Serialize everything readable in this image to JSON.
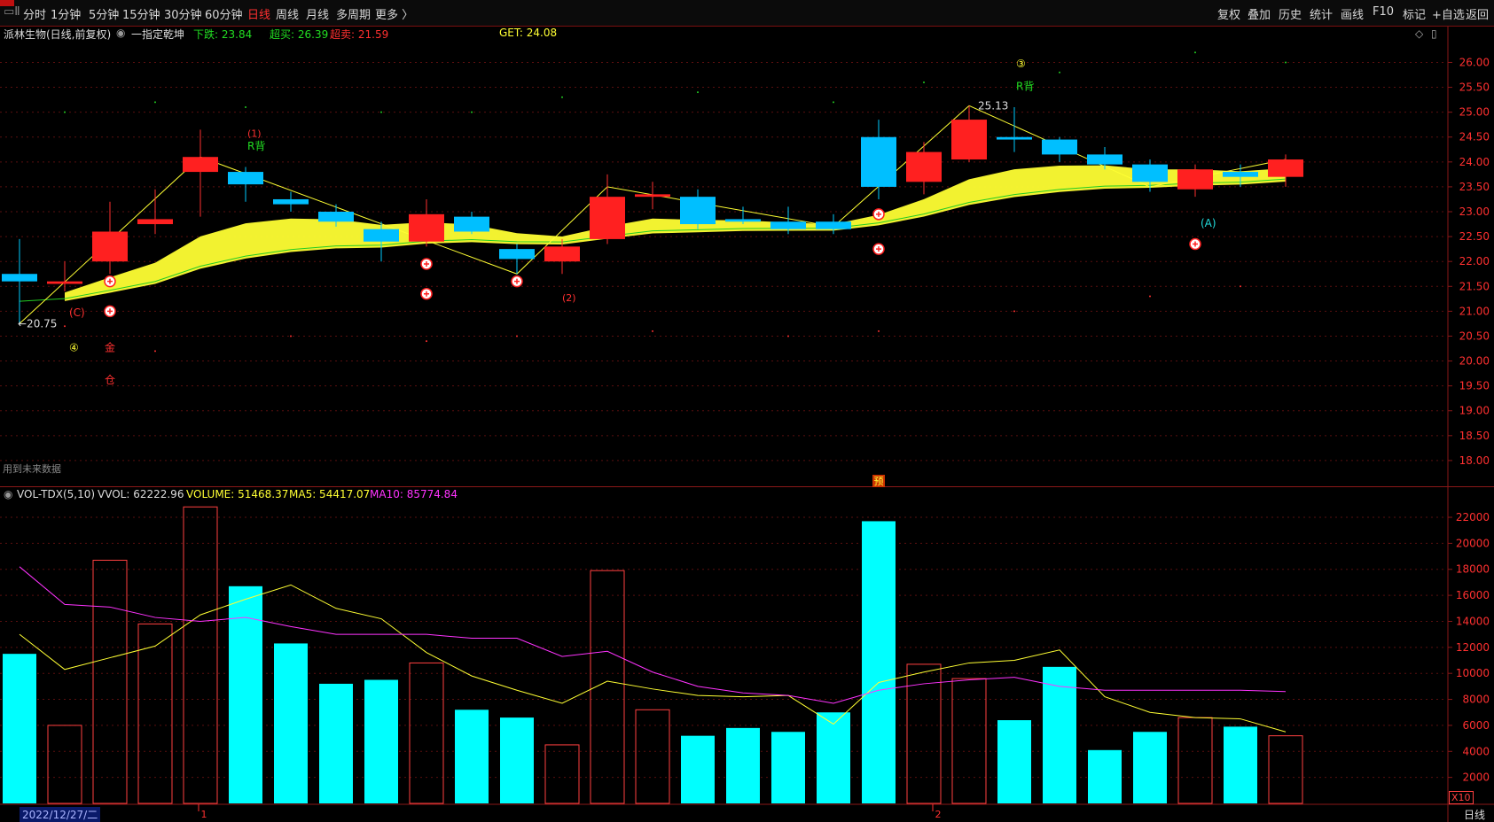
{
  "toolbar": {
    "left_tabs": [
      "分时",
      "1分钟",
      "5分钟",
      "15分钟",
      "30分钟",
      "60分钟",
      "日线",
      "周线",
      "月线",
      "多周期",
      "更多 〉"
    ],
    "active_tab": "日线",
    "right_tools": [
      "复权",
      "叠加",
      "历史",
      "统计",
      "画线",
      "F10",
      "标记",
      "+自选",
      "返回"
    ]
  },
  "header": {
    "stock_name": "派林生物(日线,前复权)",
    "indicator_name": "一指定乾坤",
    "down_label": "下跌: 23.84",
    "overbuy_label": "超买: 26.39",
    "oversell_label": "超卖: 21.59",
    "get_label": "GET: 24.08"
  },
  "volume_header": {
    "name": "VOL-TDX(5,10)",
    "vvol": "VVOL: 62222.96",
    "volume": "VOLUME: 51468.37",
    "ma5": "MA5: 54417.07",
    "ma10": "MA10: 85774.84"
  },
  "notes": {
    "future_data": "用到未来数据",
    "pre_badge": "预",
    "date_label": "2022/12/27/二",
    "period_label": "日线",
    "zoom_label": "X10",
    "month_markers": [
      "1",
      "2"
    ]
  },
  "annotations": {
    "low_price": "←20.75",
    "high_price": "25.13",
    "r_back_1": "R背",
    "r_back_2": "R背",
    "mark_1": "(1)",
    "mark_2": "(2)",
    "mark_3": "③",
    "mark_4": "④",
    "mark_c": "(C)",
    "mark_a": "(A)",
    "jin": "金",
    "cang": "仓"
  },
  "colors": {
    "up": "#ff2020",
    "down": "#00bfff",
    "volume_down": "#00ffff",
    "ma5": "#ffff33",
    "ma10": "#ff33ff",
    "band": "#ffff33"
  },
  "chart_data": [
    {
      "type": "candlestick",
      "title": "派林生物(日线,前复权)",
      "y_ticks": [
        18.0,
        18.5,
        19.0,
        19.5,
        20.0,
        20.5,
        21.0,
        21.5,
        22.0,
        22.5,
        23.0,
        23.5,
        24.0,
        24.5,
        25.0,
        25.5,
        26.0
      ],
      "ylim": [
        17.5,
        26.4
      ],
      "candles": [
        {
          "o": 21.75,
          "c": 21.6,
          "h": 22.45,
          "l": 20.75
        },
        {
          "o": 21.55,
          "c": 21.6,
          "h": 22.0,
          "l": 21.4
        },
        {
          "o": 22.0,
          "c": 22.6,
          "h": 23.2,
          "l": 21.75
        },
        {
          "o": 22.75,
          "c": 22.85,
          "h": 23.45,
          "l": 22.55
        },
        {
          "o": 23.8,
          "c": 24.1,
          "h": 24.65,
          "l": 22.9
        },
        {
          "o": 23.8,
          "c": 23.55,
          "h": 23.9,
          "l": 23.2
        },
        {
          "o": 23.25,
          "c": 23.15,
          "h": 23.4,
          "l": 23.0
        },
        {
          "o": 23.0,
          "c": 22.8,
          "h": 23.15,
          "l": 22.7
        },
        {
          "o": 22.65,
          "c": 22.4,
          "h": 22.8,
          "l": 22.0
        },
        {
          "o": 22.4,
          "c": 22.95,
          "h": 23.25,
          "l": 22.3
        },
        {
          "o": 22.9,
          "c": 22.6,
          "h": 23.0,
          "l": 22.55
        },
        {
          "o": 22.25,
          "c": 22.05,
          "h": 22.35,
          "l": 21.75
        },
        {
          "o": 22.0,
          "c": 22.3,
          "h": 22.45,
          "l": 21.75
        },
        {
          "o": 22.45,
          "c": 23.3,
          "h": 23.75,
          "l": 22.35
        },
        {
          "o": 23.3,
          "c": 23.35,
          "h": 23.6,
          "l": 23.05
        },
        {
          "o": 23.3,
          "c": 22.75,
          "h": 23.45,
          "l": 22.65
        },
        {
          "o": 22.85,
          "c": 22.8,
          "h": 23.1,
          "l": 22.75
        },
        {
          "o": 22.8,
          "c": 22.65,
          "h": 23.1,
          "l": 22.55
        },
        {
          "o": 22.8,
          "c": 22.65,
          "h": 22.95,
          "l": 22.55
        },
        {
          "o": 24.5,
          "c": 23.5,
          "h": 24.85,
          "l": 23.25
        },
        {
          "o": 23.6,
          "c": 24.2,
          "h": 24.4,
          "l": 23.35
        },
        {
          "o": 24.05,
          "c": 24.85,
          "h": 25.13,
          "l": 24.0
        },
        {
          "o": 24.5,
          "c": 24.45,
          "h": 25.1,
          "l": 24.2
        },
        {
          "o": 24.45,
          "c": 24.15,
          "h": 24.5,
          "l": 24.0
        },
        {
          "o": 24.15,
          "c": 23.95,
          "h": 24.3,
          "l": 23.85
        },
        {
          "o": 23.95,
          "c": 23.6,
          "h": 24.05,
          "l": 23.4
        },
        {
          "o": 23.45,
          "c": 23.85,
          "h": 23.95,
          "l": 23.3
        },
        {
          "o": 23.8,
          "c": 23.7,
          "h": 23.95,
          "l": 23.5
        },
        {
          "o": 23.7,
          "c": 24.05,
          "h": 24.15,
          "l": 23.5
        }
      ]
    },
    {
      "type": "bar",
      "title": "VOL-TDX(5,10)",
      "y_ticks": [
        2000,
        4000,
        6000,
        8000,
        10000,
        12000,
        14000,
        16000,
        18000,
        20000,
        22000
      ],
      "ylim": [
        0,
        23500
      ],
      "volume": [
        11500,
        6000,
        18700,
        13800,
        22800,
        16700,
        12300,
        9200,
        9500,
        10800,
        7200,
        6600,
        4500,
        17900,
        7200,
        5200,
        5800,
        5500,
        7000,
        21700,
        10700,
        9600,
        6400,
        10500,
        4100,
        5500,
        6600,
        5900,
        5200
      ],
      "up_flags": [
        false,
        true,
        true,
        true,
        true,
        false,
        false,
        false,
        false,
        true,
        false,
        false,
        true,
        true,
        true,
        false,
        false,
        false,
        false,
        false,
        true,
        true,
        false,
        false,
        false,
        false,
        true,
        false,
        true
      ],
      "ma5": [
        13000,
        10300,
        11200,
        12100,
        14500,
        15700,
        16800,
        15000,
        14200,
        11600,
        9800,
        8700,
        7700,
        9400,
        8800,
        8300,
        8200,
        8300,
        6100,
        9300,
        10100,
        10800,
        11000,
        11800,
        8200,
        7000,
        6600,
        6500,
        5500
      ],
      "ma10": [
        18200,
        15300,
        15100,
        14300,
        14000,
        14300,
        13600,
        13000,
        13000,
        13000,
        12700,
        12700,
        11300,
        11700,
        10100,
        9000,
        8500,
        8300,
        7700,
        8700,
        9200,
        9500,
        9700,
        9000,
        8700,
        8700,
        8700,
        8700,
        8600
      ]
    }
  ]
}
